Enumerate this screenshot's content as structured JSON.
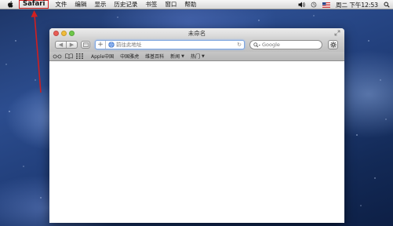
{
  "menubar": {
    "app_name": "Safari",
    "items": [
      "文件",
      "编辑",
      "显示",
      "历史记录",
      "书签",
      "窗口",
      "帮助"
    ],
    "clock": "周二 下午12:53"
  },
  "window": {
    "title": "未命名",
    "address_placeholder": "前往此地址",
    "search_placeholder": "Google",
    "bookmarks": [
      {
        "label": "Apple中国",
        "dropdown": false
      },
      {
        "label": "中国雅虎",
        "dropdown": false
      },
      {
        "label": "维基百科",
        "dropdown": false
      },
      {
        "label": "新闻",
        "dropdown": true
      },
      {
        "label": "热门",
        "dropdown": true
      }
    ]
  },
  "annotation": {
    "color": "#d21f1f"
  }
}
